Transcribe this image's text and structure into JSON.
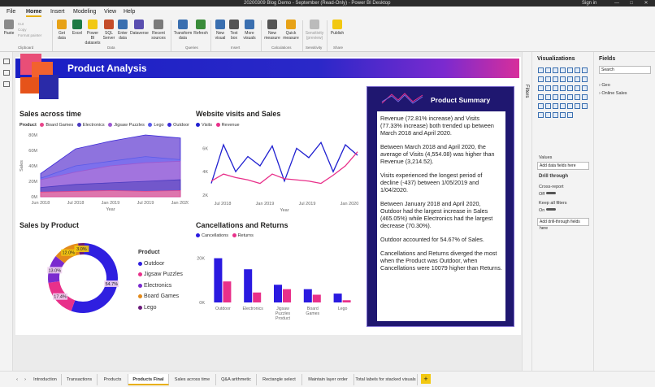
{
  "window": {
    "title": "20200309 Blog Demo - September (Read-Only) - Power BI Desktop",
    "sign_in": "Sign in"
  },
  "menu": [
    "File",
    "Home",
    "Insert",
    "Modeling",
    "View",
    "Help"
  ],
  "ribbon": {
    "buttons": [
      {
        "label": "Paste",
        "color": "#8a8a8a"
      },
      {
        "label": "Get data",
        "color": "#e7a217"
      },
      {
        "label": "Excel",
        "color": "#1d7a44"
      },
      {
        "label": "Power BI datasets",
        "color": "#f2c811"
      },
      {
        "label": "SQL Server",
        "color": "#c44c2a"
      },
      {
        "label": "Enter data",
        "color": "#3a6fb0"
      },
      {
        "label": "Dataverse",
        "color": "#5a4fb0"
      },
      {
        "label": "Recent sources",
        "color": "#7a7a7a"
      },
      {
        "label": "Transform data",
        "color": "#3a6fb0"
      },
      {
        "label": "Refresh",
        "color": "#3a8c3a"
      },
      {
        "label": "New visual",
        "color": "#3a6fb0"
      },
      {
        "label": "Text box",
        "color": "#555555"
      },
      {
        "label": "More visuals",
        "color": "#3a6fb0"
      },
      {
        "label": "New measure",
        "color": "#555555"
      },
      {
        "label": "Quick measure",
        "color": "#e7a217"
      },
      {
        "label": "Sensitivity (preview)",
        "color": "#999999"
      },
      {
        "label": "Publish",
        "color": "#f2c811"
      }
    ],
    "clipboard_small": [
      "Cut",
      "Copy",
      "Format painter"
    ],
    "groups": [
      "Clipboard",
      "Data",
      "Queries",
      "Insert",
      "Calculations",
      "Sensitivity",
      "Share"
    ]
  },
  "report": {
    "header_title": "Product Analysis"
  },
  "sales_time": {
    "title": "Sales across time",
    "legend_title": "Product",
    "legend": [
      {
        "name": "Board Games",
        "color": "#e8468a"
      },
      {
        "name": "Electronics",
        "color": "#4a3ac0"
      },
      {
        "name": "Jigsaw Puzzles",
        "color": "#9b59d0"
      },
      {
        "name": "Lego",
        "color": "#5b5be8"
      },
      {
        "name": "Outdoor",
        "color": "#3a2ad8"
      }
    ],
    "y_ticks": [
      "0M",
      "20M",
      "40M",
      "60M",
      "80M"
    ],
    "x_ticks": [
      "Jun 2018",
      "Jul 2018",
      "Jan 2019",
      "Jul 2019",
      "Jan 2020"
    ],
    "ylabel": "Sales",
    "xlabel": "Year"
  },
  "website": {
    "title": "Website visits and Sales",
    "legend": [
      {
        "name": "Visits",
        "color": "#2020d0"
      },
      {
        "name": "Revenue",
        "color": "#e8308a"
      }
    ],
    "y_ticks": [
      "2K",
      "4K",
      "6K"
    ],
    "x_ticks": [
      "Jul 2018",
      "Jan 2019",
      "Jul 2019",
      "Jan 2020"
    ],
    "xlabel": "Year"
  },
  "sales_product": {
    "title": "Sales by Product",
    "legend_title": "Product",
    "legend": [
      {
        "name": "Outdoor",
        "color": "#2f1fe0"
      },
      {
        "name": "Jigsaw Puzzles",
        "color": "#e8308a"
      },
      {
        "name": "Electronics",
        "color": "#7a2acf"
      },
      {
        "name": "Board Games",
        "color": "#e38a1a"
      },
      {
        "name": "Lego",
        "color": "#6a1a7a"
      }
    ],
    "labels": [
      "54.7%",
      "17.4%",
      "13.0%",
      "12.0%",
      "3.0%"
    ]
  },
  "cancellations": {
    "title": "Cancellations and Returns",
    "legend": [
      {
        "name": "Cancellations",
        "color": "#2a1ae0"
      },
      {
        "name": "Returns",
        "color": "#e8308a"
      }
    ],
    "y_ticks": [
      "0K",
      "20K"
    ],
    "categories": [
      "Outdoor",
      "Electronics",
      "Jigsaw Puzzles Product",
      "Board Games",
      "Lego"
    ]
  },
  "summary": {
    "title": "Product Summary",
    "p1": "Revenue (72.81% increase) and Visits (77.33% increase) both trended up between March 2018 and April 2020.",
    "p2": "Between March 2018 and April 2020, the average of Visits (4,554.08) was higher than Revenue (3,214.52).",
    "p3": "Visits experienced the longest period of decline (-437) between 1/05/2019 and 1/04/2020.",
    "p4": "Between January 2018 and April 2020, Outdoor had the largest increase in Sales (465.05%) while Electronics had the largest decrease (70.30%).",
    "p5": "Outdoor accounted for 54.67% of Sales.",
    "p6": "Cancellations and Returns diverged the most when the Product was Outdoor, when Cancellations were 10079 higher than Returns."
  },
  "filters_label": "Filters",
  "visualizations": {
    "title": "Visualizations",
    "values": "Values",
    "add_fields": "Add data fields here",
    "drill": "Drill through",
    "cross_report": "Cross-report",
    "off": "Off",
    "keep_filters": "Keep all filters",
    "on": "On",
    "add_drill": "Add drill-through fields here"
  },
  "fields": {
    "title": "Fields",
    "search": "Search",
    "items": [
      "Geo",
      "Online Sales"
    ]
  },
  "tabs": [
    "Introduction",
    "Transactions",
    "Products",
    "Products Final",
    "Sales across time",
    "Q&A arithmetic",
    "Rectangle select",
    "Maintain layer order",
    "Total labels for stacked visuals"
  ],
  "active_tab": "Products Final",
  "chart_data": [
    {
      "type": "area",
      "title": "Sales across time",
      "xlabel": "Year",
      "ylabel": "Sales",
      "ylim": [
        0,
        80
      ],
      "x": [
        "Jun 2018",
        "Jul 2018",
        "Jan 2019",
        "Jul 2019",
        "Jan 2020"
      ],
      "series": [
        {
          "name": "Board Games",
          "values": [
            6,
            7,
            8,
            7,
            8
          ]
        },
        {
          "name": "Electronics",
          "values": [
            12,
            16,
            18,
            20,
            22
          ]
        },
        {
          "name": "Jigsaw Puzzles",
          "values": [
            22,
            32,
            40,
            44,
            46
          ]
        },
        {
          "name": "Lego",
          "values": [
            24,
            40,
            46,
            52,
            48
          ]
        },
        {
          "name": "Outdoor",
          "values": [
            30,
            62,
            72,
            80,
            76
          ]
        }
      ]
    },
    {
      "type": "line",
      "title": "Website visits and Sales",
      "xlabel": "Year",
      "ylim": [
        2,
        7
      ],
      "x": [
        "Jul 2018",
        "Jan 2019",
        "Jul 2019",
        "Jan 2020"
      ],
      "series": [
        {
          "name": "Visits",
          "values": [
            3.0,
            6.3,
            4.0,
            5.3,
            4.5,
            6.2,
            3.2,
            6.0,
            5.2,
            6.5,
            4.0,
            6.3,
            5.4
          ]
        },
        {
          "name": "Revenue",
          "values": [
            3.2,
            3.8,
            3.5,
            3.3,
            3.0,
            3.8,
            3.4,
            3.3,
            3.2,
            3.0,
            3.7,
            4.5,
            5.7
          ]
        }
      ]
    },
    {
      "type": "pie",
      "title": "Sales by Product",
      "categories": [
        "Outdoor",
        "Jigsaw Puzzles",
        "Electronics",
        "Board Games",
        "Lego"
      ],
      "values": [
        54.7,
        17.4,
        13.0,
        12.0,
        3.0
      ]
    },
    {
      "type": "bar",
      "title": "Cancellations and Returns",
      "ylim": [
        0,
        25
      ],
      "categories": [
        "Outdoor",
        "Electronics",
        "Jigsaw Puzzles Product",
        "Board Games",
        "Lego"
      ],
      "series": [
        {
          "name": "Cancellations",
          "values": [
            20,
            15,
            8,
            6,
            4
          ]
        },
        {
          "name": "Returns",
          "values": [
            9.5,
            4.5,
            6,
            3.5,
            1
          ]
        }
      ]
    }
  ]
}
